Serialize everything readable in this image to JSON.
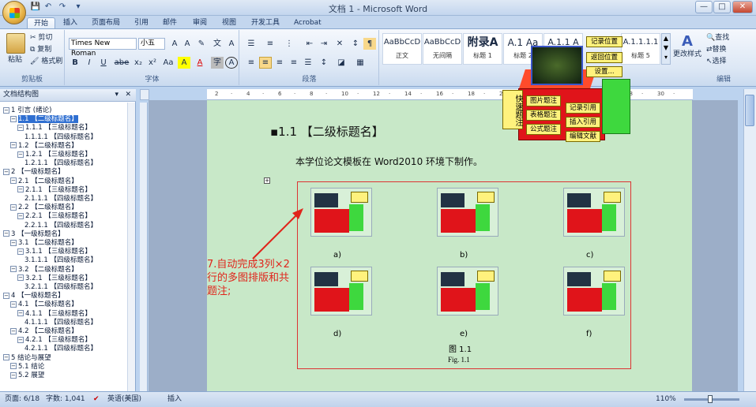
{
  "window": {
    "title": "文档 1 - Microsoft Word",
    "min": "—",
    "max": "□",
    "close": "✕"
  },
  "quick_access": [
    "💾",
    "↶",
    "↷",
    "▾"
  ],
  "tabs": [
    "开始",
    "插入",
    "页面布局",
    "引用",
    "邮件",
    "审阅",
    "视图",
    "开发工具",
    "Acrobat"
  ],
  "ribbon": {
    "clipboard": {
      "paste": "粘贴",
      "cut": "剪切",
      "copy": "复制",
      "format_painter": "格式刷",
      "label": "剪贴板"
    },
    "font": {
      "name": "Times New Roman",
      "size": "小五",
      "label": "字体",
      "buttons": [
        "B",
        "I",
        "U",
        "abe",
        "x₂",
        "x²",
        "Aa",
        "A",
        "A",
        "字",
        "A"
      ]
    },
    "paragraph": {
      "label": "段落"
    },
    "styles": {
      "items": [
        {
          "preview": "AaBbCcD",
          "name": "正文"
        },
        {
          "preview": "AaBbCcD",
          "name": "无间隔"
        },
        {
          "preview": "附录A",
          "name": "标题 1"
        },
        {
          "preview": "A.1 Aa",
          "name": "标题 2"
        },
        {
          "preview": "A.1.1 A",
          "name": "标题 3"
        },
        {
          "preview": "A.1.1.1.1",
          "name": "标题 5"
        }
      ],
      "change_styles": "更改样式"
    },
    "editing": {
      "find": "查找",
      "replace": "替换",
      "select": "选择",
      "label": "编辑"
    }
  },
  "popup": {
    "record_position": "记录位置",
    "return_position": "返回位置",
    "settings": "设置...",
    "quick_caption": "快速题注",
    "figure_caption": "图片题注",
    "table_caption": "表格题注",
    "formula_caption": "公式题注",
    "record_citation": "记录引用",
    "insert_citation": "插入引用",
    "edit_reference": "编辑文献"
  },
  "nav": {
    "title": "文档结构图",
    "items": [
      {
        "text": "1 引言 (绪论)",
        "level": 0
      },
      {
        "text": "1.1 【二级标题名】",
        "level": 1,
        "selected": true
      },
      {
        "text": "1.1.1 【三级标题名】",
        "level": 2
      },
      {
        "text": "1.1.1.1 【四级标题名】",
        "level": 3
      },
      {
        "text": "1.2 【二级标题名】",
        "level": 1
      },
      {
        "text": "1.2.1 【三级标题名】",
        "level": 2
      },
      {
        "text": "1.2.1.1 【四级标题名】",
        "level": 3
      },
      {
        "text": "2 【一级标题名】",
        "level": 0
      },
      {
        "text": "2.1 【二级标题名】",
        "level": 1
      },
      {
        "text": "2.1.1 【三级标题名】",
        "level": 2
      },
      {
        "text": "2.1.1.1 【四级标题名】",
        "level": 3
      },
      {
        "text": "2.2 【二级标题名】",
        "level": 1
      },
      {
        "text": "2.2.1 【三级标题名】",
        "level": 2
      },
      {
        "text": "2.2.1.1 【四级标题名】",
        "level": 3
      },
      {
        "text": "3 【一级标题名】",
        "level": 0
      },
      {
        "text": "3.1 【二级标题名】",
        "level": 1
      },
      {
        "text": "3.1.1 【三级标题名】",
        "level": 2
      },
      {
        "text": "3.1.1.1 【四级标题名】",
        "level": 3
      },
      {
        "text": "3.2 【二级标题名】",
        "level": 1
      },
      {
        "text": "3.2.1 【三级标题名】",
        "level": 2
      },
      {
        "text": "3.2.1.1 【四级标题名】",
        "level": 3
      },
      {
        "text": "4 【一级标题名】",
        "level": 0
      },
      {
        "text": "4.1 【二级标题名】",
        "level": 1
      },
      {
        "text": "4.1.1 【三级标题名】",
        "level": 2
      },
      {
        "text": "4.1.1.1 【四级标题名】",
        "level": 3
      },
      {
        "text": "4.2 【二级标题名】",
        "level": 1
      },
      {
        "text": "4.2.1 【三级标题名】",
        "level": 2
      },
      {
        "text": "4.2.1.1 【四级标题名】",
        "level": 3
      },
      {
        "text": "5 结论与展望",
        "level": 0
      },
      {
        "text": "5.1 结论",
        "level": 1
      },
      {
        "text": "5.2 展望",
        "level": 1
      }
    ]
  },
  "document": {
    "heading": "1.1 【二级标题名】",
    "body": "本学位论文模板在 Word2010 环境下制作。",
    "subfig_labels": [
      "a)",
      "b)",
      "c)",
      "d)",
      "e)",
      "f)"
    ],
    "caption_cn": "图 1.1",
    "caption_en": "Fig. 1.1",
    "annotation": "7.自动完成3列×2行的多图排版和共题注;"
  },
  "status": {
    "page": "页面: 6/18",
    "words": "字数: 1,041",
    "language": "英语(美国)",
    "mode": "插入",
    "zoom": "110%"
  },
  "colors": {
    "annotation": "#e0241b",
    "page_bg": "#c8e8c8",
    "accent": "#2f6fd1"
  }
}
